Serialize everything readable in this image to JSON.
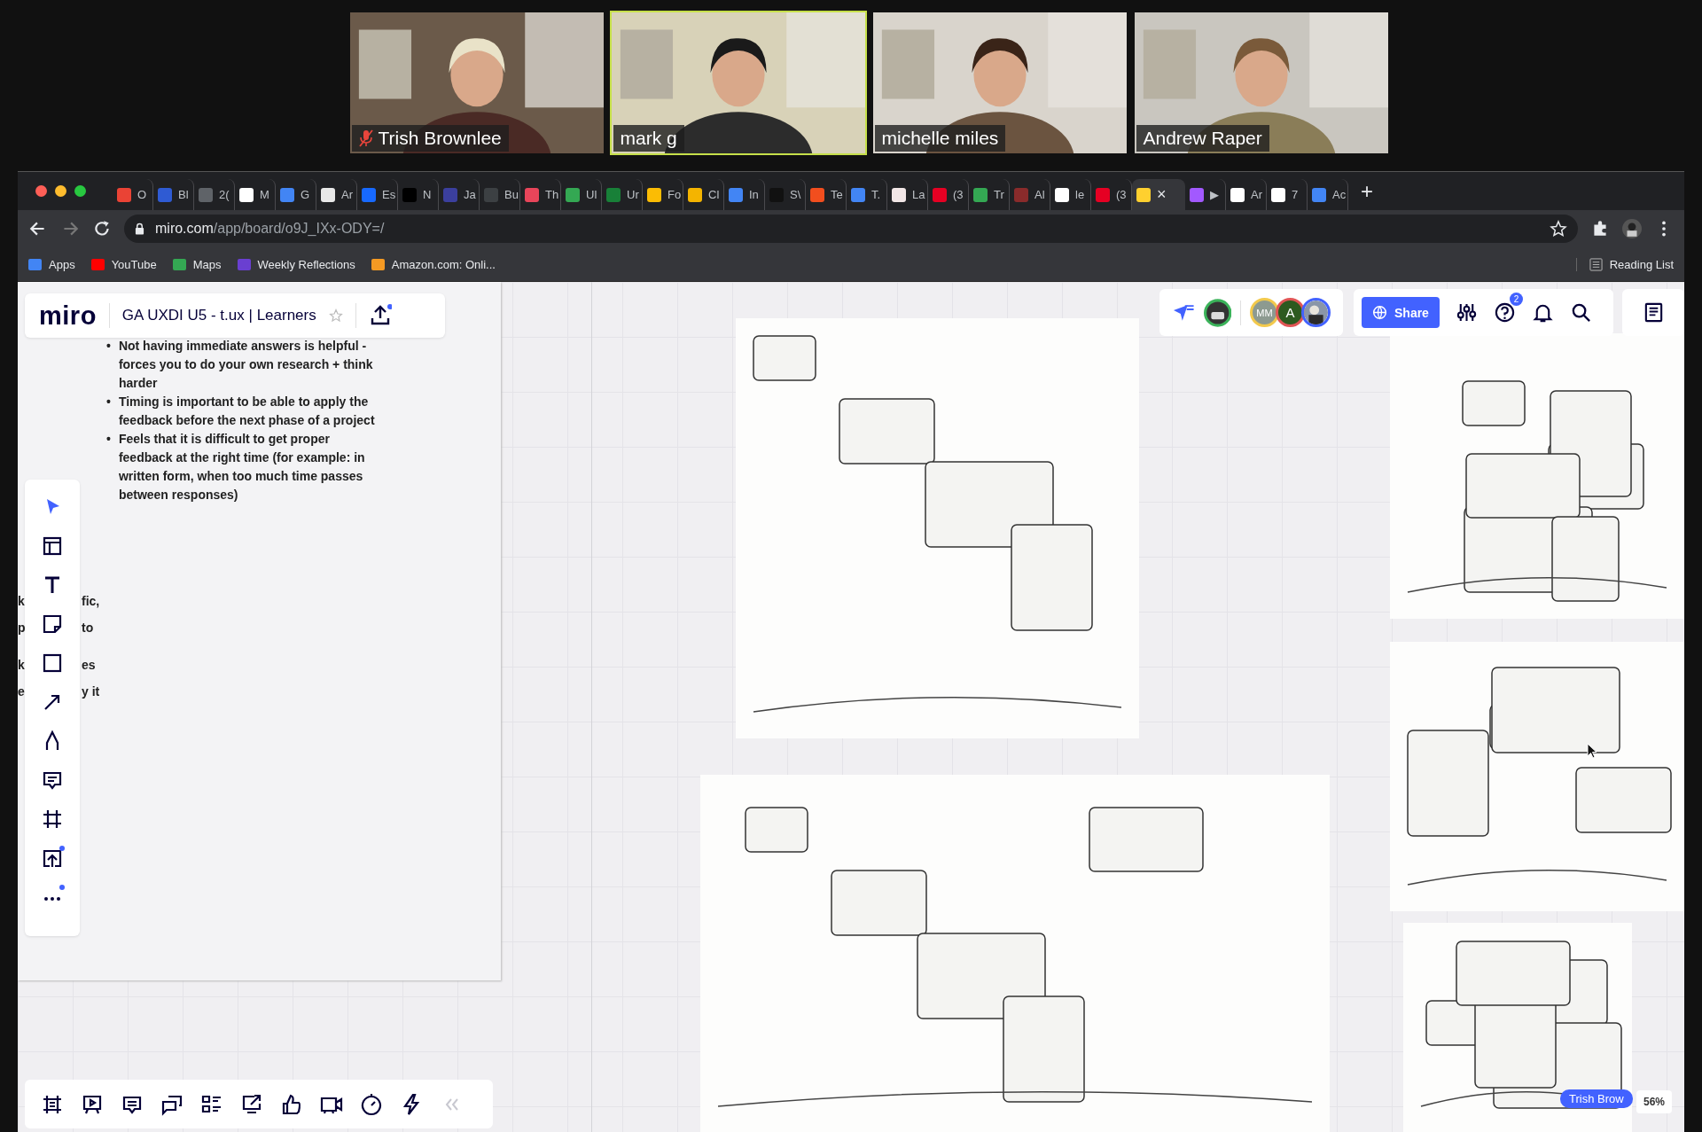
{
  "video_tiles": [
    {
      "name": "Trish Brownlee",
      "muted": true,
      "selected": false
    },
    {
      "name": "mark g",
      "muted": false,
      "selected": true
    },
    {
      "name": "michelle miles",
      "muted": false,
      "selected": false
    },
    {
      "name": "Andrew Raper",
      "muted": false,
      "selected": false
    }
  ],
  "browser": {
    "tabs": [
      {
        "label": "O",
        "color": "#ea4335",
        "selected": false
      },
      {
        "label": "Bl",
        "color": "#2f5bd3",
        "selected": false
      },
      {
        "label": "2(",
        "color": "#5f6368",
        "selected": false
      },
      {
        "label": "M",
        "color": "#ffffff",
        "selected": false
      },
      {
        "label": "G",
        "color": "#4285f4",
        "selected": false
      },
      {
        "label": "Ar",
        "color": "#e8e8e8",
        "selected": false
      },
      {
        "label": "Es",
        "color": "#1769ff",
        "selected": false
      },
      {
        "label": "N",
        "color": "#000000",
        "selected": false
      },
      {
        "label": "Ja",
        "color": "#3b3f9e",
        "selected": false
      },
      {
        "label": "Bu",
        "color": "#3c4043",
        "selected": false
      },
      {
        "label": "Th",
        "color": "#e8455a",
        "selected": false
      },
      {
        "label": "Ul",
        "color": "#34a853",
        "selected": false
      },
      {
        "label": "Ur",
        "color": "#188038",
        "selected": false
      },
      {
        "label": "Fo",
        "color": "#fbbc04",
        "selected": false
      },
      {
        "label": "Cl",
        "color": "#f4b400",
        "selected": false
      },
      {
        "label": "In",
        "color": "#4285f4",
        "selected": false
      },
      {
        "label": "S\\",
        "color": "#111111",
        "selected": false
      },
      {
        "label": "Te",
        "color": "#f24e1e",
        "selected": false
      },
      {
        "label": "T.",
        "color": "#4285f4",
        "selected": false
      },
      {
        "label": "La",
        "color": "#f1e6e6",
        "selected": false
      },
      {
        "label": "(3",
        "color": "#e60023",
        "selected": false
      },
      {
        "label": "Tr",
        "color": "#34a853",
        "selected": false
      },
      {
        "label": "Al",
        "color": "#8a2b2b",
        "selected": false
      },
      {
        "label": "le",
        "color": "#ffffff",
        "selected": false
      },
      {
        "label": "(3",
        "color": "#e60023",
        "selected": false
      },
      {
        "color": "#ffd02f",
        "selected": true
      },
      {
        "label": "▶",
        "color": "#a259ff",
        "selected": false
      },
      {
        "label": "Ar",
        "color": "#ffffff",
        "selected": false
      },
      {
        "label": "7",
        "color": "#ffffff",
        "selected": false
      },
      {
        "label": "Ac",
        "color": "#4285f4",
        "selected": false
      }
    ],
    "close_tab": "×",
    "new_tab": "+",
    "host": "miro.com",
    "path": "/app/board/o9J_IXx-ODY=/",
    "bookmarks": [
      {
        "label": "Apps",
        "color": "#4285f4"
      },
      {
        "label": "YouTube",
        "color": "#ff0000"
      },
      {
        "label": "Maps",
        "color": "#34a853"
      },
      {
        "label": "Weekly Reflections",
        "color": "#6a3fd1"
      },
      {
        "label": "Amazon.com: Onli...",
        "color": "#f59a23"
      }
    ],
    "reading_list": "Reading List"
  },
  "board": {
    "logo": "miro",
    "title": "GA UXDI U5 - t.ux | Learners",
    "starred": false,
    "notes": [
      {
        "marker": "•",
        "text": "Not having immediate answers is helpful - forces you to do your own research + think harder"
      },
      {
        "marker": "•",
        "text": "Timing is important to be able to apply the feedback before the next phase of a project"
      },
      {
        "marker": "•",
        "text": "Feels that it is difficult to get proper feedback at the right time (for example: in written form, when too much time passes between responses)"
      }
    ],
    "fragments": [
      {
        "left": "k",
        "right": "fic,"
      },
      {
        "left": "p",
        "right": "to"
      },
      {
        "left": "k",
        "right": "es"
      },
      {
        "left": "e",
        "right": "y it"
      }
    ],
    "left_tools": [
      {
        "kind": "select",
        "selected": true,
        "dot": false
      },
      {
        "kind": "templates",
        "selected": false,
        "dot": false
      },
      {
        "kind": "text",
        "selected": false,
        "dot": false
      },
      {
        "kind": "sticky",
        "selected": false,
        "dot": false
      },
      {
        "kind": "shape",
        "selected": false,
        "dot": false
      },
      {
        "kind": "arrow",
        "selected": false,
        "dot": false
      },
      {
        "kind": "pen",
        "selected": false,
        "dot": false
      },
      {
        "kind": "comment",
        "selected": false,
        "dot": false
      },
      {
        "kind": "frame",
        "selected": false,
        "dot": false
      },
      {
        "kind": "upload",
        "selected": false,
        "dot": true
      },
      {
        "kind": "more",
        "selected": false,
        "dot": true
      }
    ],
    "bottom_tools": [
      {
        "kind": "frames"
      },
      {
        "kind": "present"
      },
      {
        "kind": "notes"
      },
      {
        "kind": "chat"
      },
      {
        "kind": "list"
      },
      {
        "kind": "screen"
      },
      {
        "kind": "vote"
      },
      {
        "kind": "video"
      },
      {
        "kind": "timer"
      },
      {
        "kind": "lightning"
      },
      {
        "kind": "collapse"
      }
    ],
    "avatars": [
      {
        "initials": "MM",
        "color": "#f2c94c"
      },
      {
        "initials": "A",
        "color": "#e05555"
      },
      {
        "kind": "picture",
        "color": "#4262ff"
      }
    ],
    "share": "Share",
    "help_badge": "2",
    "sketches": [
      {
        "kind": "picture"
      },
      {
        "kind": "picture"
      },
      {
        "kind": "picture"
      },
      {
        "kind": "picture"
      },
      {
        "kind": "picture"
      }
    ],
    "cursor_label": "Trish Brow",
    "zoom": "56%"
  }
}
